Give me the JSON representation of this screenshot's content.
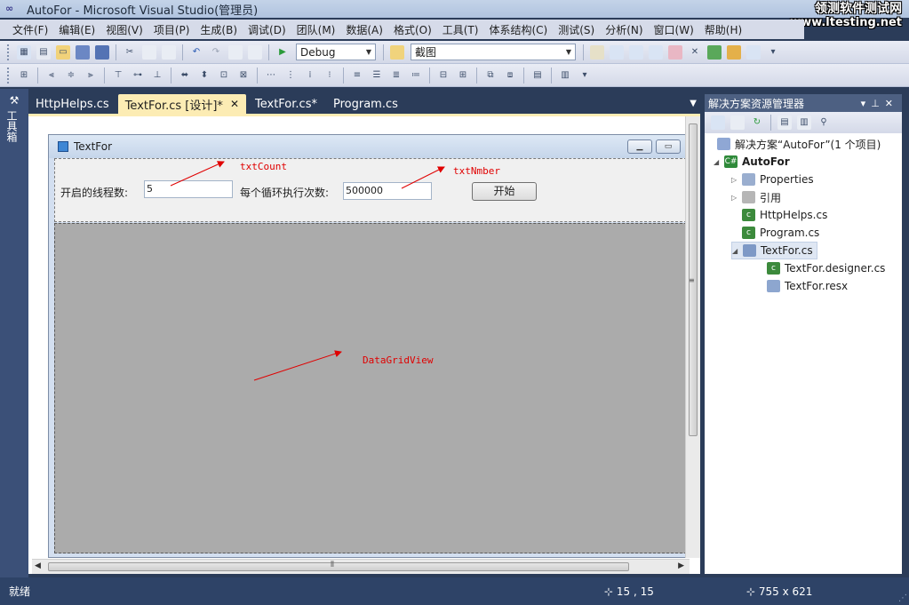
{
  "window": {
    "title": "AutoFor - Microsoft Visual Studio(管理员)",
    "app_icon": "∞"
  },
  "watermark": {
    "line1": "领测软件测试网",
    "line2": "www.ltesting.net"
  },
  "menu": [
    "文件(F)",
    "编辑(E)",
    "视图(V)",
    "项目(P)",
    "生成(B)",
    "调试(D)",
    "团队(M)",
    "数据(A)",
    "格式(O)",
    "工具(T)",
    "体系结构(C)",
    "测试(S)",
    "分析(N)",
    "窗口(W)",
    "帮助(H)"
  ],
  "toolbar1": {
    "config_value": "Debug",
    "find_value": "截图"
  },
  "toolbox_strip": {
    "label": "工具箱"
  },
  "doc_tabs": [
    {
      "label": "HttpHelps.cs",
      "active": false
    },
    {
      "label": "TextFor.cs [设计]*",
      "active": true
    },
    {
      "label": "TextFor.cs*",
      "active": false
    },
    {
      "label": "Program.cs",
      "active": false
    }
  ],
  "form": {
    "title": "TextFor",
    "label_threads": "开启的线程数:",
    "txtCount_value": "5",
    "label_loops": "每个循环执行次数:",
    "txtNumber_value": "500000",
    "start_button": "开始"
  },
  "annotations": {
    "txtCount": "txtCount",
    "txtNmber": "txtNmber",
    "datagrid": "DataGridView"
  },
  "solution_explorer": {
    "title": "解决方案资源管理器",
    "items": [
      {
        "label": "解决方案“AutoFor”(1 个项目)",
        "icon": "solution-icon",
        "bold": false
      },
      {
        "label": "AutoFor",
        "icon": "csharp-project-icon",
        "bold": true
      },
      {
        "label": "Properties",
        "icon": "properties-folder-icon",
        "bold": false
      },
      {
        "label": "引用",
        "icon": "references-folder-icon",
        "bold": false
      },
      {
        "label": "HttpHelps.cs",
        "icon": "csharp-file-icon",
        "bold": false
      },
      {
        "label": "Program.cs",
        "icon": "csharp-file-icon",
        "bold": false
      },
      {
        "label": "TextFor.cs",
        "icon": "form-file-icon",
        "bold": false
      },
      {
        "label": "TextFor.designer.cs",
        "icon": "csharp-file-icon",
        "bold": false
      },
      {
        "label": "TextFor.resx",
        "icon": "resx-file-icon",
        "bold": false
      }
    ]
  },
  "statusbar": {
    "text": "就绪",
    "position": "15 , 15",
    "size": "755 x 621"
  },
  "colors": {
    "accent_tab": "#fcecb4",
    "chrome_dark": "#2b3c59",
    "annotation_red": "#e00000",
    "grid_gray": "#ababab"
  }
}
